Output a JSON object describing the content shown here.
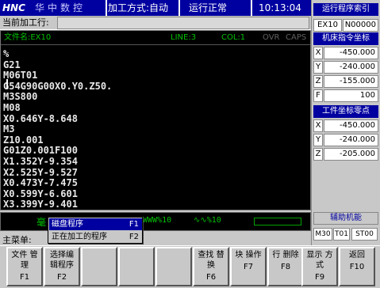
{
  "header": {
    "logo": "HNC",
    "brand": "华中数控",
    "mode": "加工方式:自动",
    "run_status": "运行正常",
    "clock": "10:13:04"
  },
  "current_line": {
    "label": "当前加工行:",
    "value": ""
  },
  "editor": {
    "file_label": "文件名:EX10",
    "line_label": "LINE:3",
    "col_label": "COL:1",
    "ovr": "OVR",
    "caps": "CAPS",
    "lines": [
      "%",
      "G21",
      "M06T01",
      "G54G90G00X0.Y0.Z50.",
      "M3S800",
      "M08",
      "X0.646Y-8.648",
      "M3",
      "Z10.001",
      "G01Z0.001F100",
      "X1.352Y-9.354",
      "X2.525Y-9.527",
      "X0.473Y-7.475",
      "X0.599Y-6.601",
      "X3.399Y-9.401"
    ]
  },
  "gauges": {
    "unit": "毫",
    "feed": "WWW%10",
    "spindle": "∿∿%10"
  },
  "popup": {
    "items": [
      {
        "label": "磁盘程序",
        "key": "F1",
        "selected": true
      },
      {
        "label": "正在加工的程序",
        "key": "F2",
        "selected": false
      }
    ]
  },
  "main_menu_label": "主菜单:",
  "fkeys": [
    {
      "label": "文件 管理",
      "key": "F1"
    },
    {
      "label": "选择编 辑程序",
      "key": "F2"
    },
    {
      "label": "",
      "key": ""
    },
    {
      "label": "",
      "key": ""
    },
    {
      "label": "",
      "key": ""
    },
    {
      "label": "查找 替换",
      "key": "F6"
    },
    {
      "label": "块 操作",
      "key": "F7"
    },
    {
      "label": "行 删除",
      "key": "F8"
    },
    {
      "label": "显示 方式",
      "key": "F9"
    },
    {
      "label": "返回",
      "key": "F10"
    }
  ],
  "right_panel": {
    "run_index_title": "运行程序索引",
    "program_name": "EX10",
    "program_number": "N00000",
    "machine_coords_title": "机床指令坐标",
    "machine_coords": [
      {
        "axis": "X",
        "value": "-450.000"
      },
      {
        "axis": "Y",
        "value": "-240.000"
      },
      {
        "axis": "Z",
        "value": "-155.000"
      },
      {
        "axis": "F",
        "value": "100"
      }
    ],
    "work_zero_title": "工件坐标零点",
    "work_zero": [
      {
        "axis": "X",
        "value": "-450.000"
      },
      {
        "axis": "Y",
        "value": "-240.000"
      },
      {
        "axis": "Z",
        "value": "-205.000"
      }
    ],
    "aux_title": "辅助机能",
    "aux_codes": [
      "M30",
      "T01",
      "ST00"
    ]
  },
  "colors": {
    "title_bg": "#0000a0",
    "editor_bg": "#000000",
    "status_green": "#00c000",
    "panel_bg": "#c8c8c8"
  }
}
